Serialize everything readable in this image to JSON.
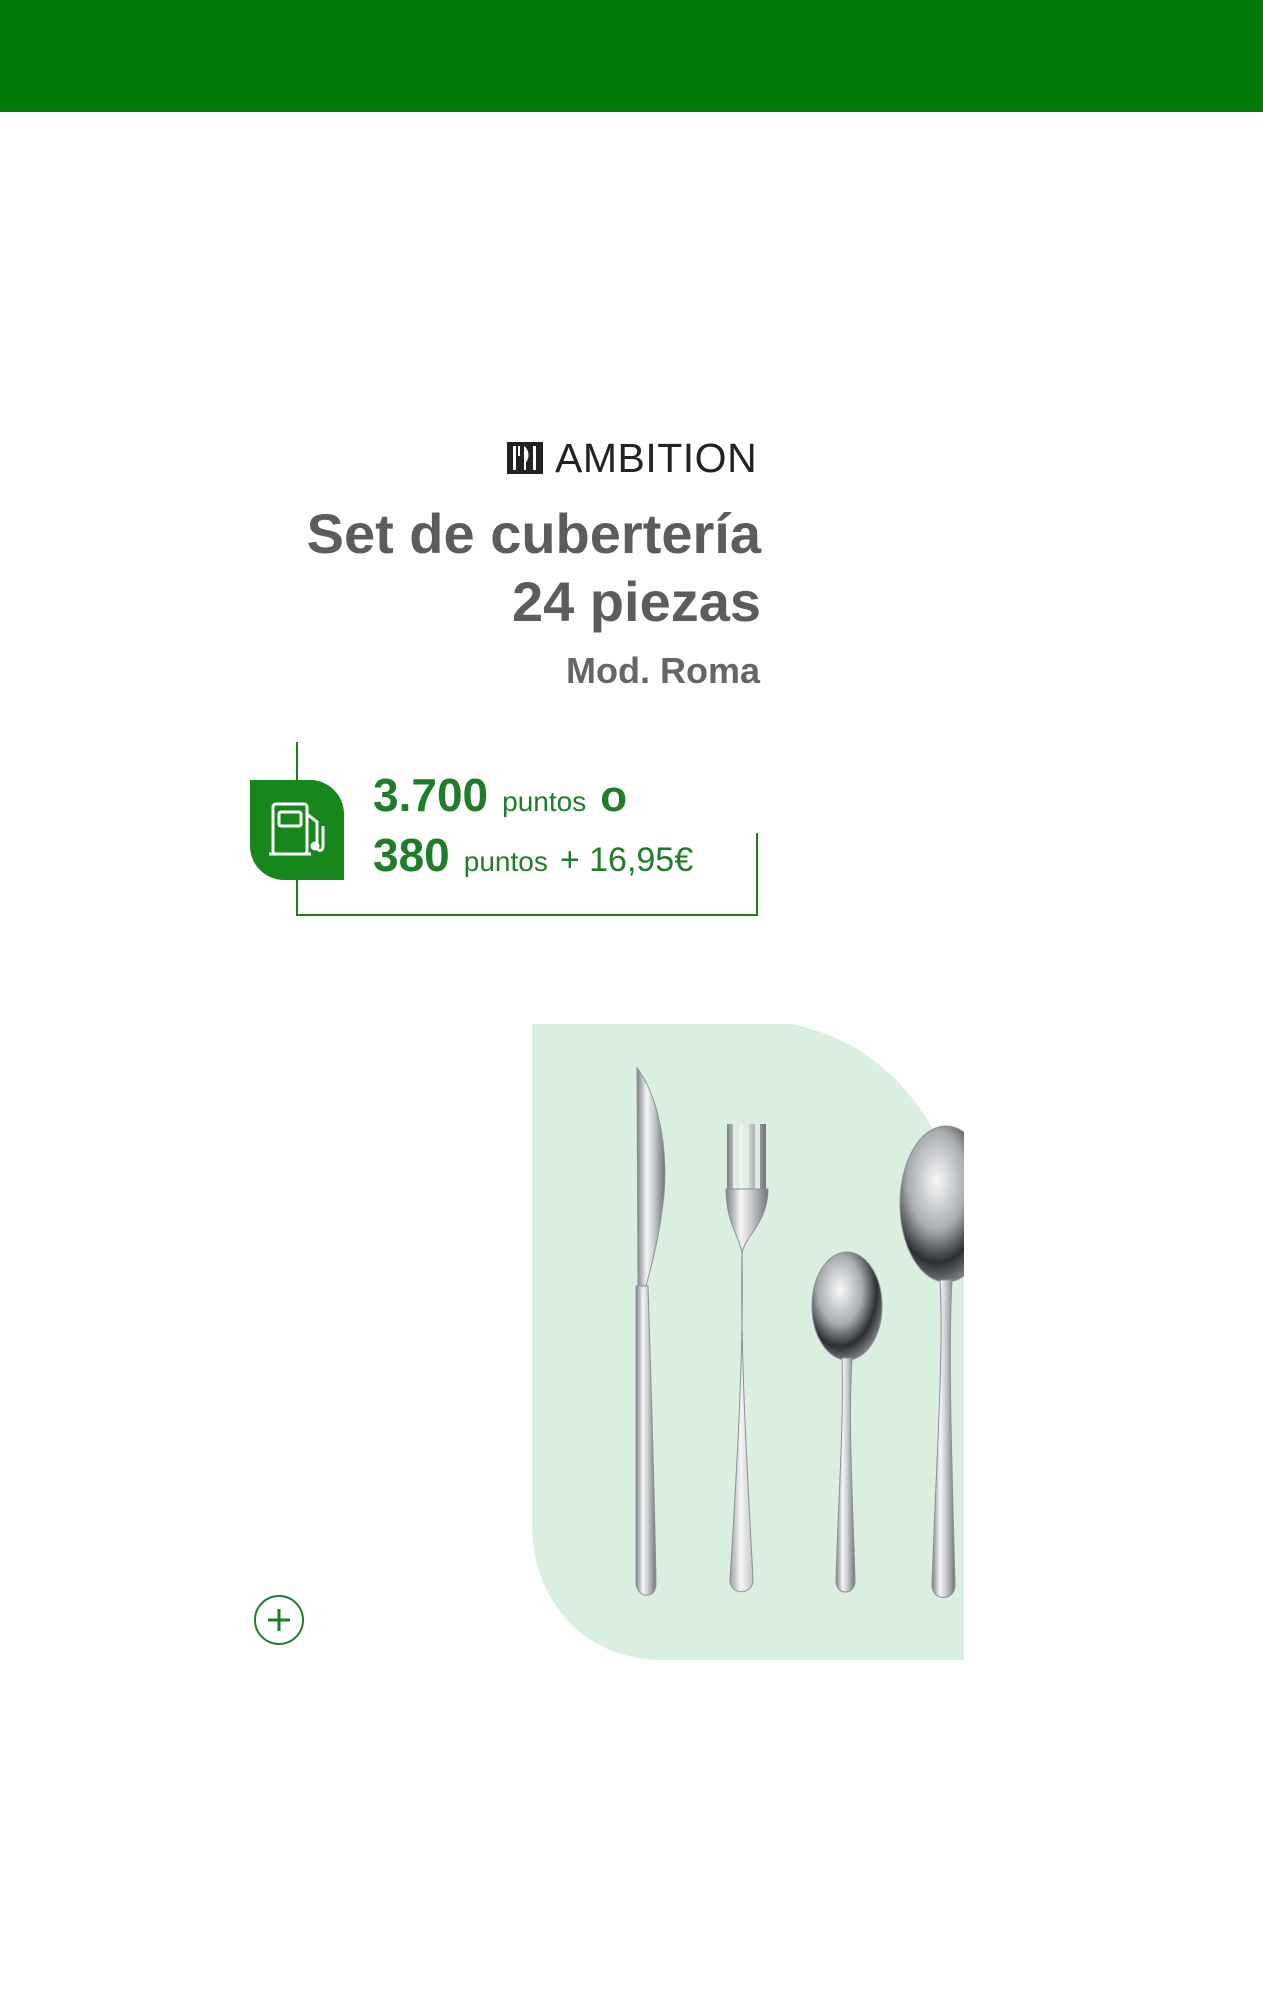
{
  "brand": {
    "name": "AMBITION",
    "logo_icon": "cutlery-logo-icon"
  },
  "product": {
    "title_lines": [
      "Set de cubertería",
      "24 piezas"
    ],
    "model": "Mod. Roma"
  },
  "price": {
    "icon": "fuel-pump-icon",
    "option1": {
      "points": "3.700",
      "unit": "puntos",
      "conjunction": "o"
    },
    "option2": {
      "points": "380",
      "unit": "puntos",
      "extra": "+ 16,95€"
    }
  },
  "actions": {
    "more_icon": "plus-icon"
  },
  "colors": {
    "brand_green": "#067a06",
    "text_green": "#1f7d2a",
    "panel_mint": "#daefdf",
    "title_gray": "#5c5c5c"
  }
}
